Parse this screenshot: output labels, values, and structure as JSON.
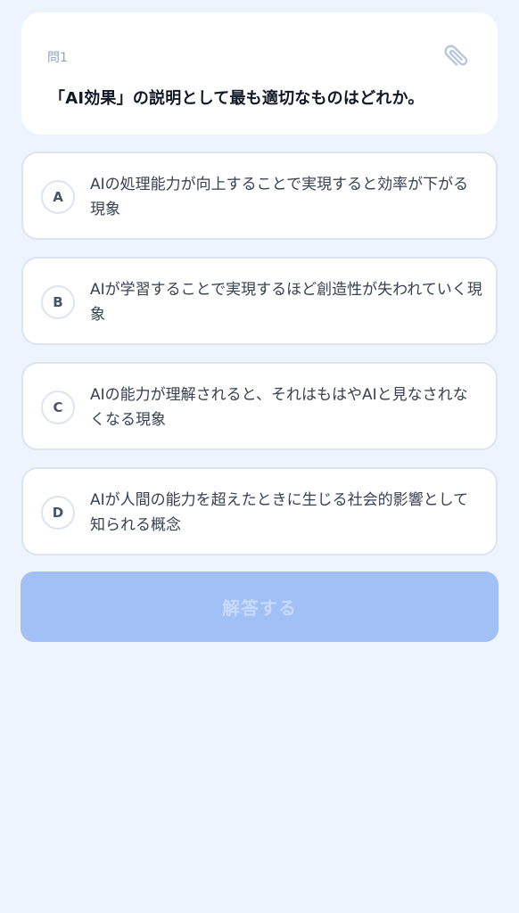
{
  "question": {
    "number": "問1",
    "text": "「AI効果」の説明として最も適切なものはどれか。",
    "icon": "paperclip-icon"
  },
  "options": [
    {
      "letter": "A",
      "text": "AIの処理能力が向上することで実現すると効率が下がる現象"
    },
    {
      "letter": "B",
      "text": "AIが学習することで実現するほど創造性が失われていく現象"
    },
    {
      "letter": "C",
      "text": "AIの能力が理解されると、それはもはやAIと見なされなくなる現象"
    },
    {
      "letter": "D",
      "text": "AIが人間の能力を超えたときに生じる社会的影響として知られる概念"
    }
  ],
  "submit": {
    "label": "解答する",
    "enabled": false
  },
  "colors": {
    "background": "#eef4fd",
    "card": "#ffffff",
    "border": "#dbe4ef",
    "submit_disabled": "#a0c0f6",
    "submit_text_disabled": "#c9dbfb"
  }
}
